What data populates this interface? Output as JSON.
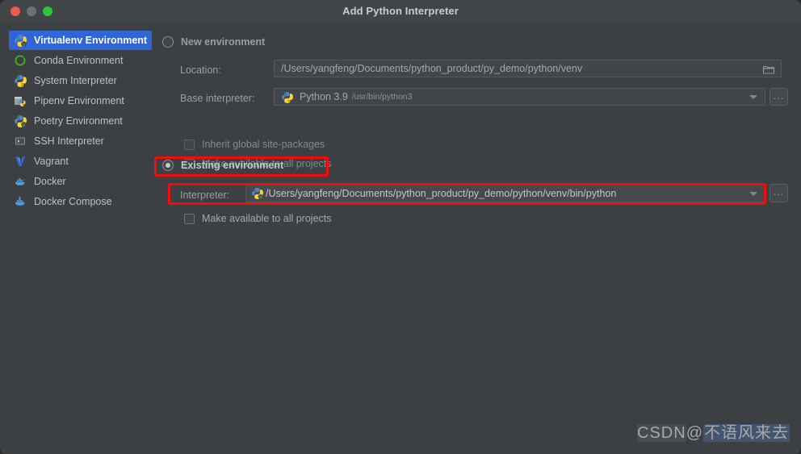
{
  "window": {
    "title": "Add Python Interpreter",
    "traffic_lights": [
      "close-button",
      "minimize-button",
      "maximize-button"
    ],
    "colors": {
      "background": "#3c4043",
      "titlebar": "#414548",
      "selection": "#2f65d4",
      "annotation": "#f20d0d"
    }
  },
  "sidebar": {
    "items": [
      {
        "label": "Virtualenv Environment",
        "icon": "virtualenv-icon",
        "selected": true
      },
      {
        "label": "Conda Environment",
        "icon": "conda-icon",
        "selected": false
      },
      {
        "label": "System Interpreter",
        "icon": "python-icon",
        "selected": false
      },
      {
        "label": "Pipenv Environment",
        "icon": "pipenv-icon",
        "selected": false
      },
      {
        "label": "Poetry Environment",
        "icon": "poetry-icon",
        "selected": false
      },
      {
        "label": "SSH Interpreter",
        "icon": "ssh-terminal-icon",
        "selected": false
      },
      {
        "label": "Vagrant",
        "icon": "vagrant-icon",
        "selected": false
      },
      {
        "label": "Docker",
        "icon": "docker-icon",
        "selected": false
      },
      {
        "label": "Docker Compose",
        "icon": "docker-compose-icon",
        "selected": false
      }
    ]
  },
  "main": {
    "new_environment": {
      "radio_label": "New environment",
      "selected": false,
      "location": {
        "label": "Location:",
        "value": "/Users/yangfeng/Documents/python_product/py_demo/python/venv",
        "browse_icon": "folder-icon"
      },
      "base_interpreter": {
        "label": "Base interpreter:",
        "value": "Python 3.9",
        "value_suffix": "/usr/bin/python3",
        "icon": "python-icon",
        "dropdown_icon": "chevron-down-icon",
        "browse_label": "..."
      },
      "checkboxes": [
        {
          "label": "Inherit global site-packages",
          "checked": false
        },
        {
          "label": "Make available to all projects",
          "checked": false
        }
      ]
    },
    "existing_environment": {
      "radio_label": "Existing environment",
      "selected": true,
      "interpreter": {
        "label": "Interpreter:",
        "value": "/Users/yangfeng/Documents/python_product/py_demo/python/venv/bin/python",
        "icon": "virtualenv-icon",
        "dropdown_icon": "chevron-down-icon",
        "browse_label": "..."
      },
      "checkboxes": [
        {
          "label": "Make available to all projects",
          "checked": false
        }
      ]
    }
  },
  "annotations": [
    {
      "name": "highlight-existing-environment-radio"
    },
    {
      "name": "highlight-interpreter-row"
    }
  ],
  "watermark": {
    "prefix": "CSDN",
    "at": "@",
    "handle": "不语风来去"
  }
}
